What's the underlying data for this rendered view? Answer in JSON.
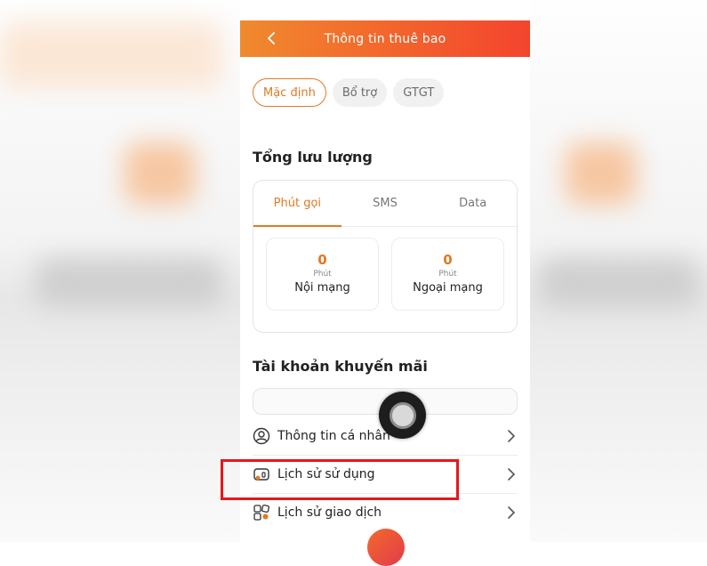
{
  "header": {
    "title": "Thông tin thuê bao"
  },
  "package_tabs": [
    {
      "label": "Mặc định",
      "active": true
    },
    {
      "label": "Bổ trợ",
      "active": false
    },
    {
      "label": "GTGT",
      "active": false
    }
  ],
  "usage": {
    "section_title": "Tổng lưu lượng",
    "tabs": [
      {
        "label": "Phút gọi",
        "active": true
      },
      {
        "label": "SMS",
        "active": false
      },
      {
        "label": "Data",
        "active": false
      }
    ],
    "stats": [
      {
        "value": "0",
        "unit": "Phút",
        "label": "Nội mạng"
      },
      {
        "value": "0",
        "unit": "Phút",
        "label": "Ngoại mạng"
      }
    ]
  },
  "promo": {
    "section_title": "Tài khoản khuyến mãi"
  },
  "menu": [
    {
      "label": "Thông tin cá nhân",
      "icon": "user-icon"
    },
    {
      "label": "Lịch sử sử dụng",
      "icon": "usage-history-icon"
    },
    {
      "label": "Lịch sử giao dịch",
      "icon": "transaction-history-icon"
    }
  ],
  "colors": {
    "accent": "#e07a24",
    "header_start": "#ef8a2e",
    "header_end": "#f3442e",
    "highlight": "#e8161c"
  }
}
